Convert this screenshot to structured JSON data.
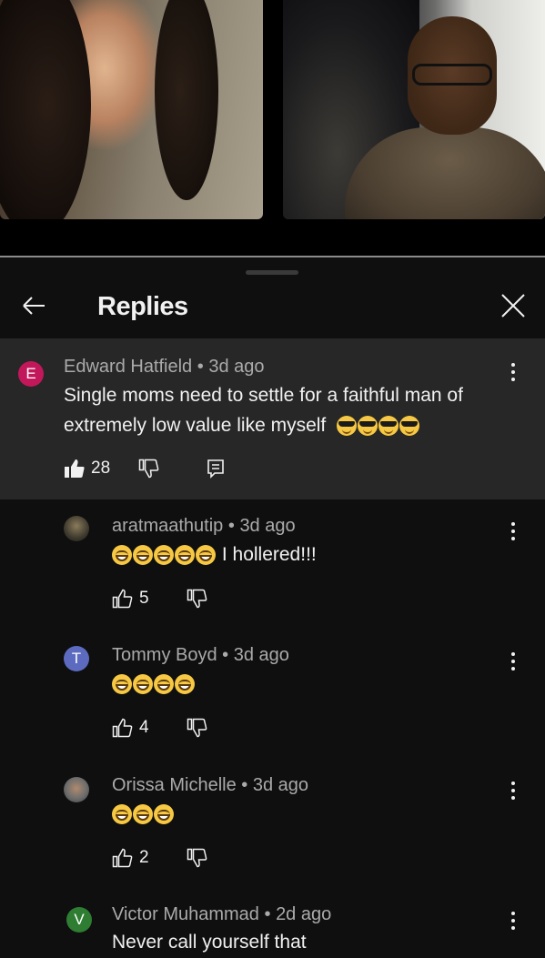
{
  "header": {
    "title": "Replies"
  },
  "parent_comment": {
    "avatar_letter": "E",
    "avatar_color": "#c2185b",
    "author": "Edward Hatfield",
    "age": "3d ago",
    "text_line1": "Single moms need to settle for a faithful man of",
    "text_line2": "extremely low value like myself",
    "emoji": [
      "smiling-face-with-sunglasses",
      "smiling-face-with-sunglasses",
      "smiling-face-with-sunglasses",
      "smiling-face-with-sunglasses"
    ],
    "likes": "28"
  },
  "replies": [
    {
      "author": "aratmaathutip",
      "age": "3d ago",
      "text": "I hollered!!!",
      "emoji_count": 5,
      "likes": "5",
      "avatar_type": "photo"
    },
    {
      "author": "Tommy Boyd",
      "age": "3d ago",
      "text": "",
      "emoji_count": 4,
      "likes": "4",
      "avatar_letter": "T",
      "avatar_color": "#5c6bc0"
    },
    {
      "author": "Orissa Michelle",
      "age": "3d ago",
      "text": "",
      "emoji_count": 3,
      "likes": "2",
      "avatar_type": "photo"
    },
    {
      "author": "Victor Muhammad",
      "age": "2d ago",
      "text": "Never call yourself that",
      "avatar_letter": "V",
      "avatar_color": "#2e7d32"
    }
  ],
  "separator": "•",
  "icons": [
    "back-arrow-icon",
    "close-icon",
    "thumbs-up-icon",
    "thumbs-down-icon",
    "reply-icon",
    "more-vert-icon"
  ]
}
